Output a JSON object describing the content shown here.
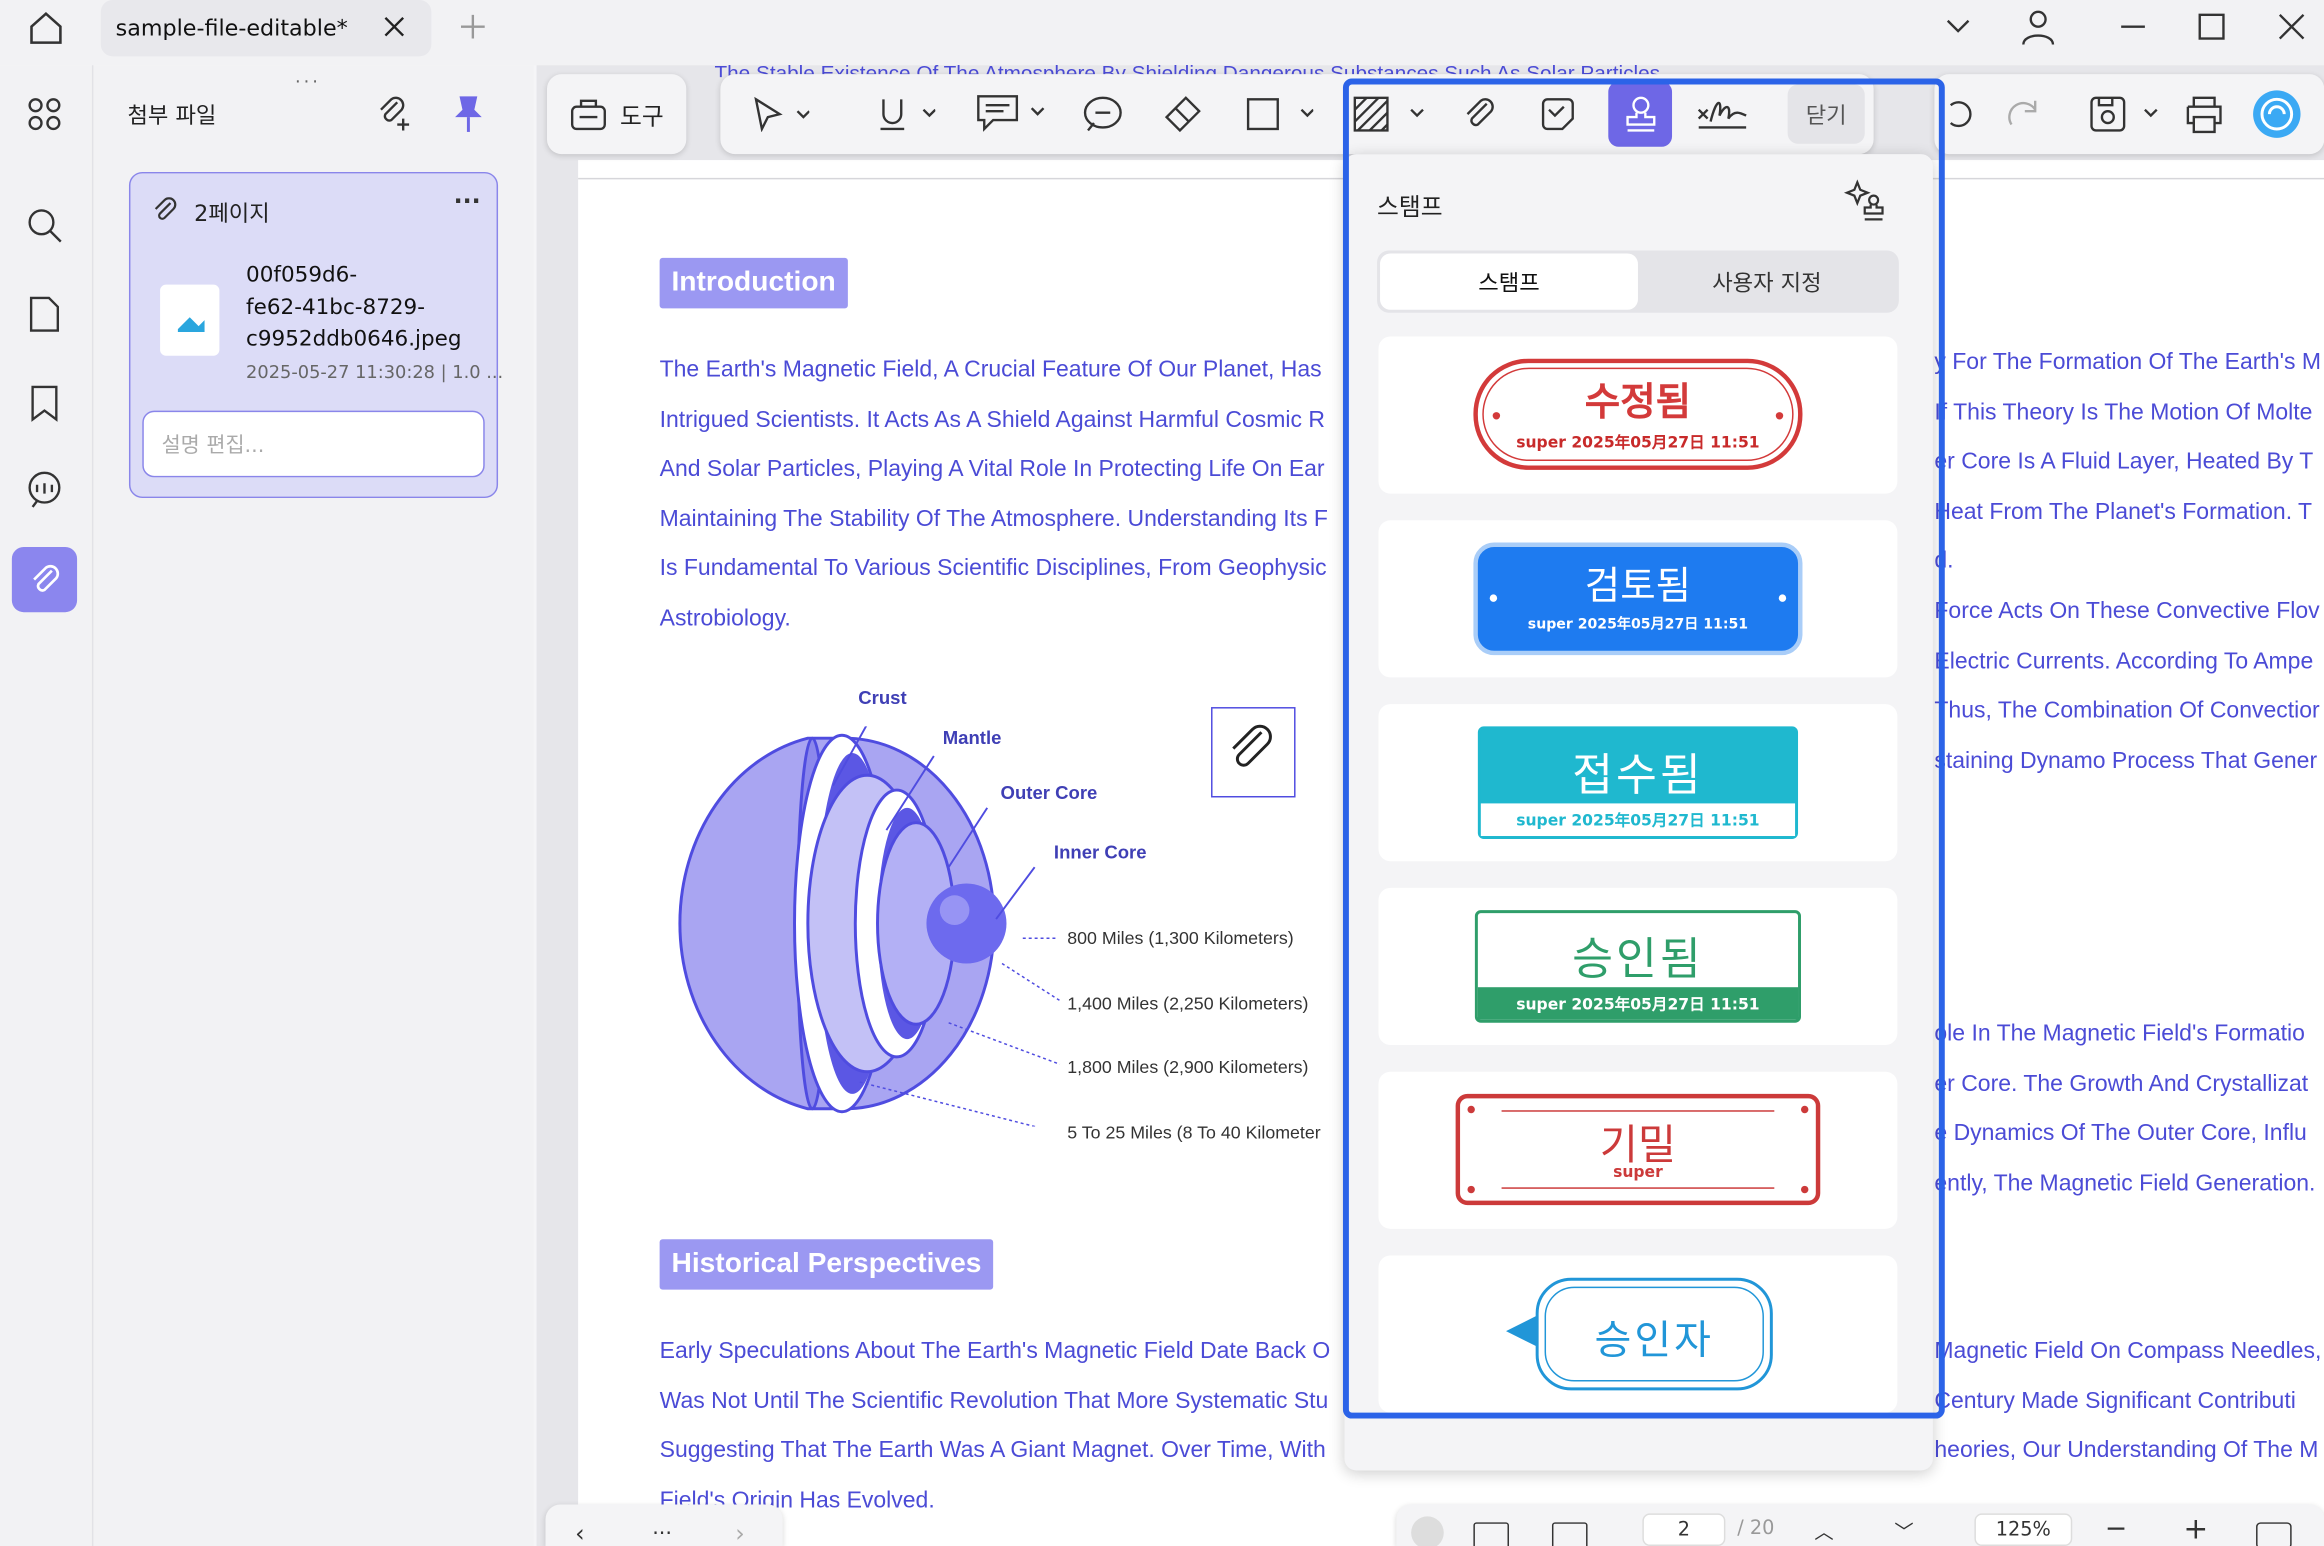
{
  "tab": {
    "title": "sample-file-editable*"
  },
  "panel": {
    "title": "첨부 파일",
    "card": {
      "page_label": "2페이지",
      "more": "···",
      "filename": [
        "00f059d6-",
        "fe62-41bc-8729-",
        "c9952ddb0646.jpeg"
      ],
      "meta": "2025-05-27 11:30:28 | 1.0 ...",
      "desc_placeholder": "설명 편집..."
    }
  },
  "toolbar": {
    "tools_label": "도구",
    "close_label": "닫기"
  },
  "document": {
    "cut_top": "The Stable Existence Of The Atmosphere By Shielding Dangerous Substances Such As Solar Particles",
    "intro_heading": "Introduction",
    "intro_lines": [
      "The Earth's Magnetic Field, A Crucial Feature Of Our Planet, Has",
      "Intrigued Scientists. It Acts As A Shield Against Harmful Cosmic R",
      "And Solar Particles, Playing A Vital Role In Protecting Life On Ear",
      "Maintaining The Stability Of The Atmosphere. Understanding Its F",
      "Is Fundamental To Various Scientific Disciplines, From Geophysic",
      "Astrobiology."
    ],
    "diagram": {
      "crust": "Crust",
      "mantle": "Mantle",
      "outer_core": "Outer Core",
      "inner_core": "Inner Core",
      "d1": "800 Miles (1,300 Kilometers)",
      "d2": "1,400 Miles (2,250 Kilometers)",
      "d3": "1,800 Miles (2,900 Kilometers)",
      "d4": "5 To 25 Miles (8 To 40 Kilometer"
    },
    "right_lines": [
      "y For The Formation Of The Earth's M",
      "If This Theory Is The Motion Of Molte",
      "er Core Is A Fluid Layer, Heated By T",
      "Heat From The Planet's Formation. T",
      "d.",
      "Force Acts On These Convective Flov",
      "Electric Currents. According To Ampe",
      "Thus, The Combination Of Convectior",
      "staining Dynamo Process That Gener"
    ],
    "right_lines2": [
      "ole In The Magnetic Field's Formatio",
      "er Core. The Growth And Crystallizat",
      "e Dynamics Of The Outer Core, Influ",
      "ently, The Magnetic Field Generation."
    ],
    "hist_heading": "Historical Perspectives",
    "hist_lines": [
      "Early Speculations About The Earth's Magnetic Field Date Back O",
      "Was Not Until The Scientific Revolution That More Systematic Stu",
      "Suggesting That The Earth Was A Giant Magnet. Over Time, With",
      "Field's Origin Has Evolved."
    ],
    "hist_right": [
      "Magnetic Field On Compass Needles,",
      "Century Made Significant Contributi",
      "heories, Our Understanding Of The M"
    ]
  },
  "stamp_panel": {
    "title": "스탬프",
    "tab_stamp": "스탬프",
    "tab_custom": "사용자 지정",
    "stamps": [
      {
        "text": "수정됨",
        "sub": "super 2025年05月27日 11:51",
        "color": "#d33a3a"
      },
      {
        "text": "검토됨",
        "sub": "super 2025年05月27日 11:51",
        "color": "#1e7bf0"
      },
      {
        "text": "접수됨",
        "sub": "super 2025年05月27日 11:51",
        "color": "#1fb8cf"
      },
      {
        "text": "승인됨",
        "sub": "super 2025年05月27日 11:51",
        "color": "#2f9e6a"
      },
      {
        "text": "기밀",
        "sub": "super",
        "color": "#cc3a3a"
      },
      {
        "text": "승인자",
        "sub": "",
        "color": "#2196d8"
      }
    ]
  },
  "bottom": {
    "page": "2",
    "total": "/ 20",
    "zoom": "125%",
    "ellipsis": "..."
  }
}
